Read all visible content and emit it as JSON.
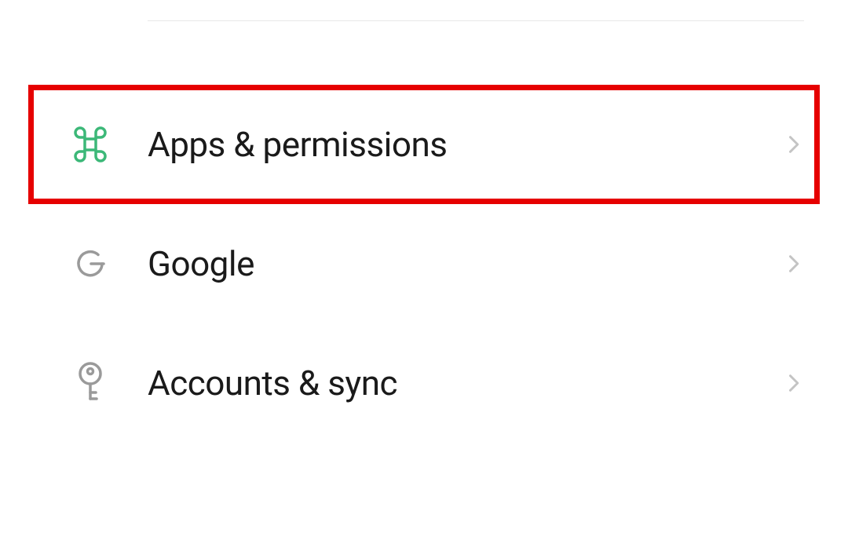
{
  "settings": {
    "items": [
      {
        "id": "apps-permissions",
        "label": "Apps & permissions",
        "icon": "command-icon",
        "iconColor": "#3cb878",
        "highlighted": true
      },
      {
        "id": "google",
        "label": "Google",
        "icon": "google-icon",
        "iconColor": "#9a9a9a",
        "highlighted": false
      },
      {
        "id": "accounts-sync",
        "label": "Accounts & sync",
        "icon": "key-icon",
        "iconColor": "#9a9a9a",
        "highlighted": false
      }
    ]
  },
  "highlightColor": "#e60000"
}
